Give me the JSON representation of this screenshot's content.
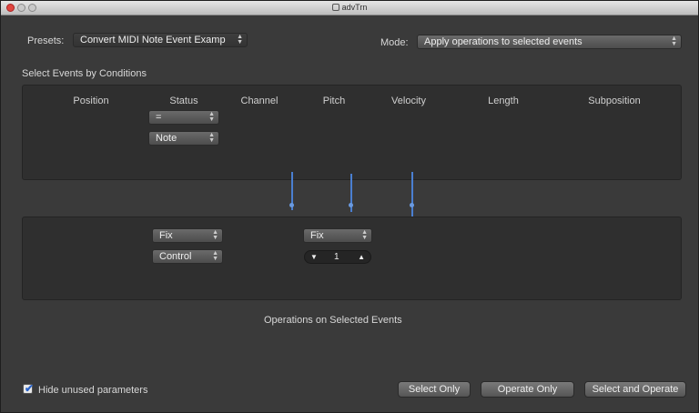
{
  "window": {
    "title": "advTrn"
  },
  "presets": {
    "label": "Presets:",
    "value": "Convert MIDI Note Event Examp"
  },
  "mode": {
    "label": "Mode:",
    "value": "Apply operations to selected events"
  },
  "section_title": "Select Events by Conditions",
  "columns": [
    "Position",
    "Status",
    "Channel",
    "Pitch",
    "Velocity",
    "Length",
    "Subposition"
  ],
  "conditions": {
    "status_operator": "=",
    "status_value": "Note"
  },
  "operations": {
    "status_op": "Fix",
    "status_value": "Control",
    "pitch_op": "Fix",
    "pitch_value": "1",
    "title": "Operations on Selected Events"
  },
  "footer": {
    "hide_unused_label": "Hide unused parameters",
    "hide_unused_checked": true,
    "select_only": "Select Only",
    "operate_only": "Operate Only",
    "select_and_operate": "Select and Operate"
  },
  "colors": {
    "accent": "#4a7fd1",
    "close": "#e0463f"
  }
}
